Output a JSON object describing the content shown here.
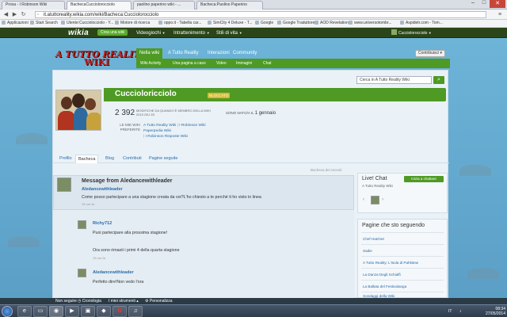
{
  "browser": {
    "tabs": [
      {
        "label": "Prova - I Robinson Wiki"
      },
      {
        "label": "BachecaCucciolorocciolo"
      },
      {
        "label": "paolino paperino wiki - ..."
      },
      {
        "label": "Bacheca:Paolino Paperino"
      }
    ],
    "url": "it.atuttoreality.wikia.com/wiki/Bacheca:Cucciolorocciolo",
    "bookmarks": [
      "Applicazioni",
      "Start Search",
      "Utente:Cucciolocciolo - Y...",
      "Motore di ricerca",
      "oppo.it - Tabella car...",
      "SimCity 4 Deluxe - T...",
      "Google",
      "Google Traduttore",
      "AOD Revelations",
      "www.universotombr...",
      "Aspidetr.com - Tom..."
    ]
  },
  "wikiabar": {
    "logo": "wikia",
    "create_label": "Crea una wiki",
    "nav": [
      "Videogiochi",
      "Intrattenimento",
      "Stili di vita"
    ],
    "user": "Cucciolorocciolo"
  },
  "wiki": {
    "logo_line1": "A TUTTO REALITY",
    "logo_line2": "WIKI",
    "nav": [
      "Nella wiki",
      "A Tutto Reality",
      "Interazioni",
      "Community"
    ],
    "subnav": [
      "Wiki Activity",
      "Una pagina a caso",
      "Video",
      "Immagini",
      "Chat"
    ],
    "contribute": "Contribuisci",
    "search_placeholder": "Cerca in A Tutto Reality Wiki"
  },
  "profile": {
    "username": "Cuccioloricciolo",
    "badge": "BLOCCATO",
    "edits": "2 392",
    "edits_desc": "MODIFICHE DA QUANDO È MEMBRO DELLA WIKI",
    "edits_date": "2013 GIU 28",
    "joined_label": "SONO NATO/A IL",
    "joined_value": "1 gennaio",
    "fav_label": "LE MIE WIKI PREFERITE",
    "fav_wikis": [
      "A Tutto Reality Wiki",
      "I Robinson Wiki",
      "Paperpedia Wiki",
      "I Robinson Risposte Wiki"
    ],
    "tabs": [
      "Profilo",
      "Bacheca",
      "Blog",
      "Contributi",
      "Pagine seguite"
    ]
  },
  "wall": {
    "hint": "Bacheca dei recenti",
    "thread_title": "Message from Aledancewithleader",
    "posts": [
      {
        "author": "Aledancewithleader",
        "text": "Come posso partecipare a una stagione creata da voi?L'ho chiesto a te perchè ti ho visto in linea",
        "time": "15 ore fa"
      },
      {
        "author": "Richy712",
        "text": "Puoi partecipare alla prossima stagione!",
        "text2": "Ora sono rimasti i primi 4 della quarta stagione",
        "time": "15 ore fa"
      },
      {
        "author": "Aledancewithleader",
        "text": "Perfetto dire!Non vedo l'ora",
        "time": ""
      }
    ]
  },
  "rail": {
    "chat_title": "Live! Chat",
    "chat_sub": "A Tutto Reality Wiki",
    "chat_btn": "Inizia a chattare",
    "follow_title": "Pagine che sto seguendo",
    "follow_items": [
      "Chef Hatchet",
      "Sadie",
      "A Tutto Reality: L'Isola di Pahkitew",
      "La Danza Degli Schiaffi",
      "La Ballata del Festivalanga",
      "Sondaggi della Wiki"
    ]
  },
  "toolbar": {
    "items": [
      "Non seguire",
      "Cronologia",
      "I miei strumenti",
      "Personalizza"
    ]
  },
  "taskbar": {
    "time": "08:34",
    "date": "27/05/2014",
    "lang": "IT"
  },
  "colors": {
    "wiki_green": "#4e9a24",
    "wikia_bar": "#2b4518",
    "badge_gold": "#d9b82d",
    "link_blue": "#2a6aa8"
  }
}
